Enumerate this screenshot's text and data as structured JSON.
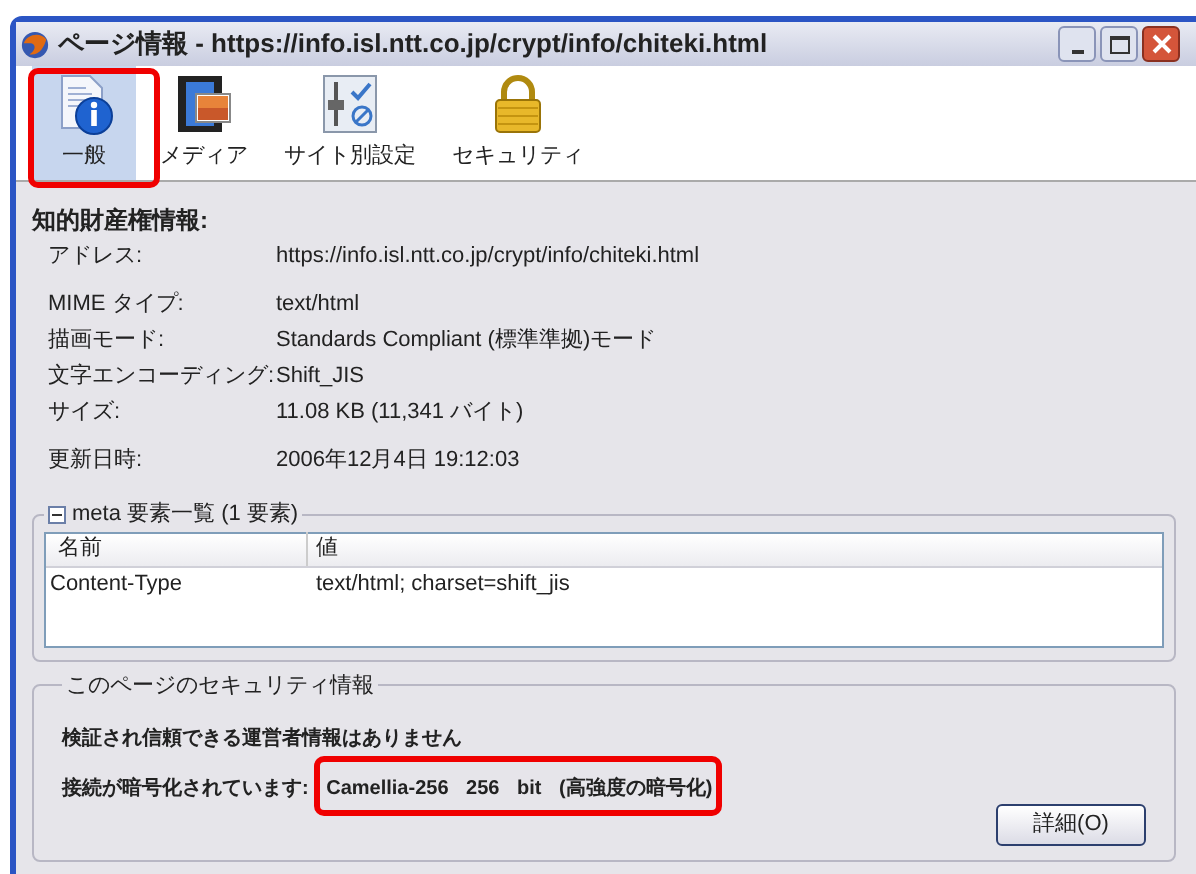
{
  "window": {
    "title": "ページ情報 - https://info.isl.ntt.co.jp/crypt/info/chiteki.html"
  },
  "tabs": [
    {
      "label": "一般",
      "selected": true,
      "kind": "info"
    },
    {
      "label": "メディア",
      "selected": false,
      "kind": "media"
    },
    {
      "label": "サイト別設定",
      "selected": false,
      "kind": "settings"
    },
    {
      "label": "セキュリティ",
      "selected": false,
      "kind": "security"
    }
  ],
  "section_title": "知的財産権情報:",
  "fields": [
    {
      "label": "アドレス:",
      "value": "https://info.isl.ntt.co.jp/crypt/info/chiteki.html"
    },
    {
      "label": "MIME タイプ:",
      "value": "text/html"
    },
    {
      "label": "描画モード:",
      "value": "Standards Compliant (標準準拠)モード"
    },
    {
      "label": "文字エンコーディング:",
      "value": "Shift_JIS"
    },
    {
      "label": "サイズ:",
      "value": "11.08 KB (11,341 バイト)"
    },
    {
      "label": "更新日時:",
      "value": "2006年12月4日 19:12:03"
    }
  ],
  "meta": {
    "title": "meta 要素一覧 (1 要素)",
    "expanded": true,
    "columns": [
      "名前",
      "値"
    ],
    "rows": [
      [
        "Content-Type",
        "text/html; charset=shift_jis"
      ]
    ]
  },
  "security": {
    "title": "このページのセキュリティ情報",
    "lines": [
      "検証され信頼できる運営者情報はありません",
      "接続が暗号化されています: Camellia-256 256 bit (高強度の暗号化)"
    ],
    "button": "詳細(O)"
  }
}
